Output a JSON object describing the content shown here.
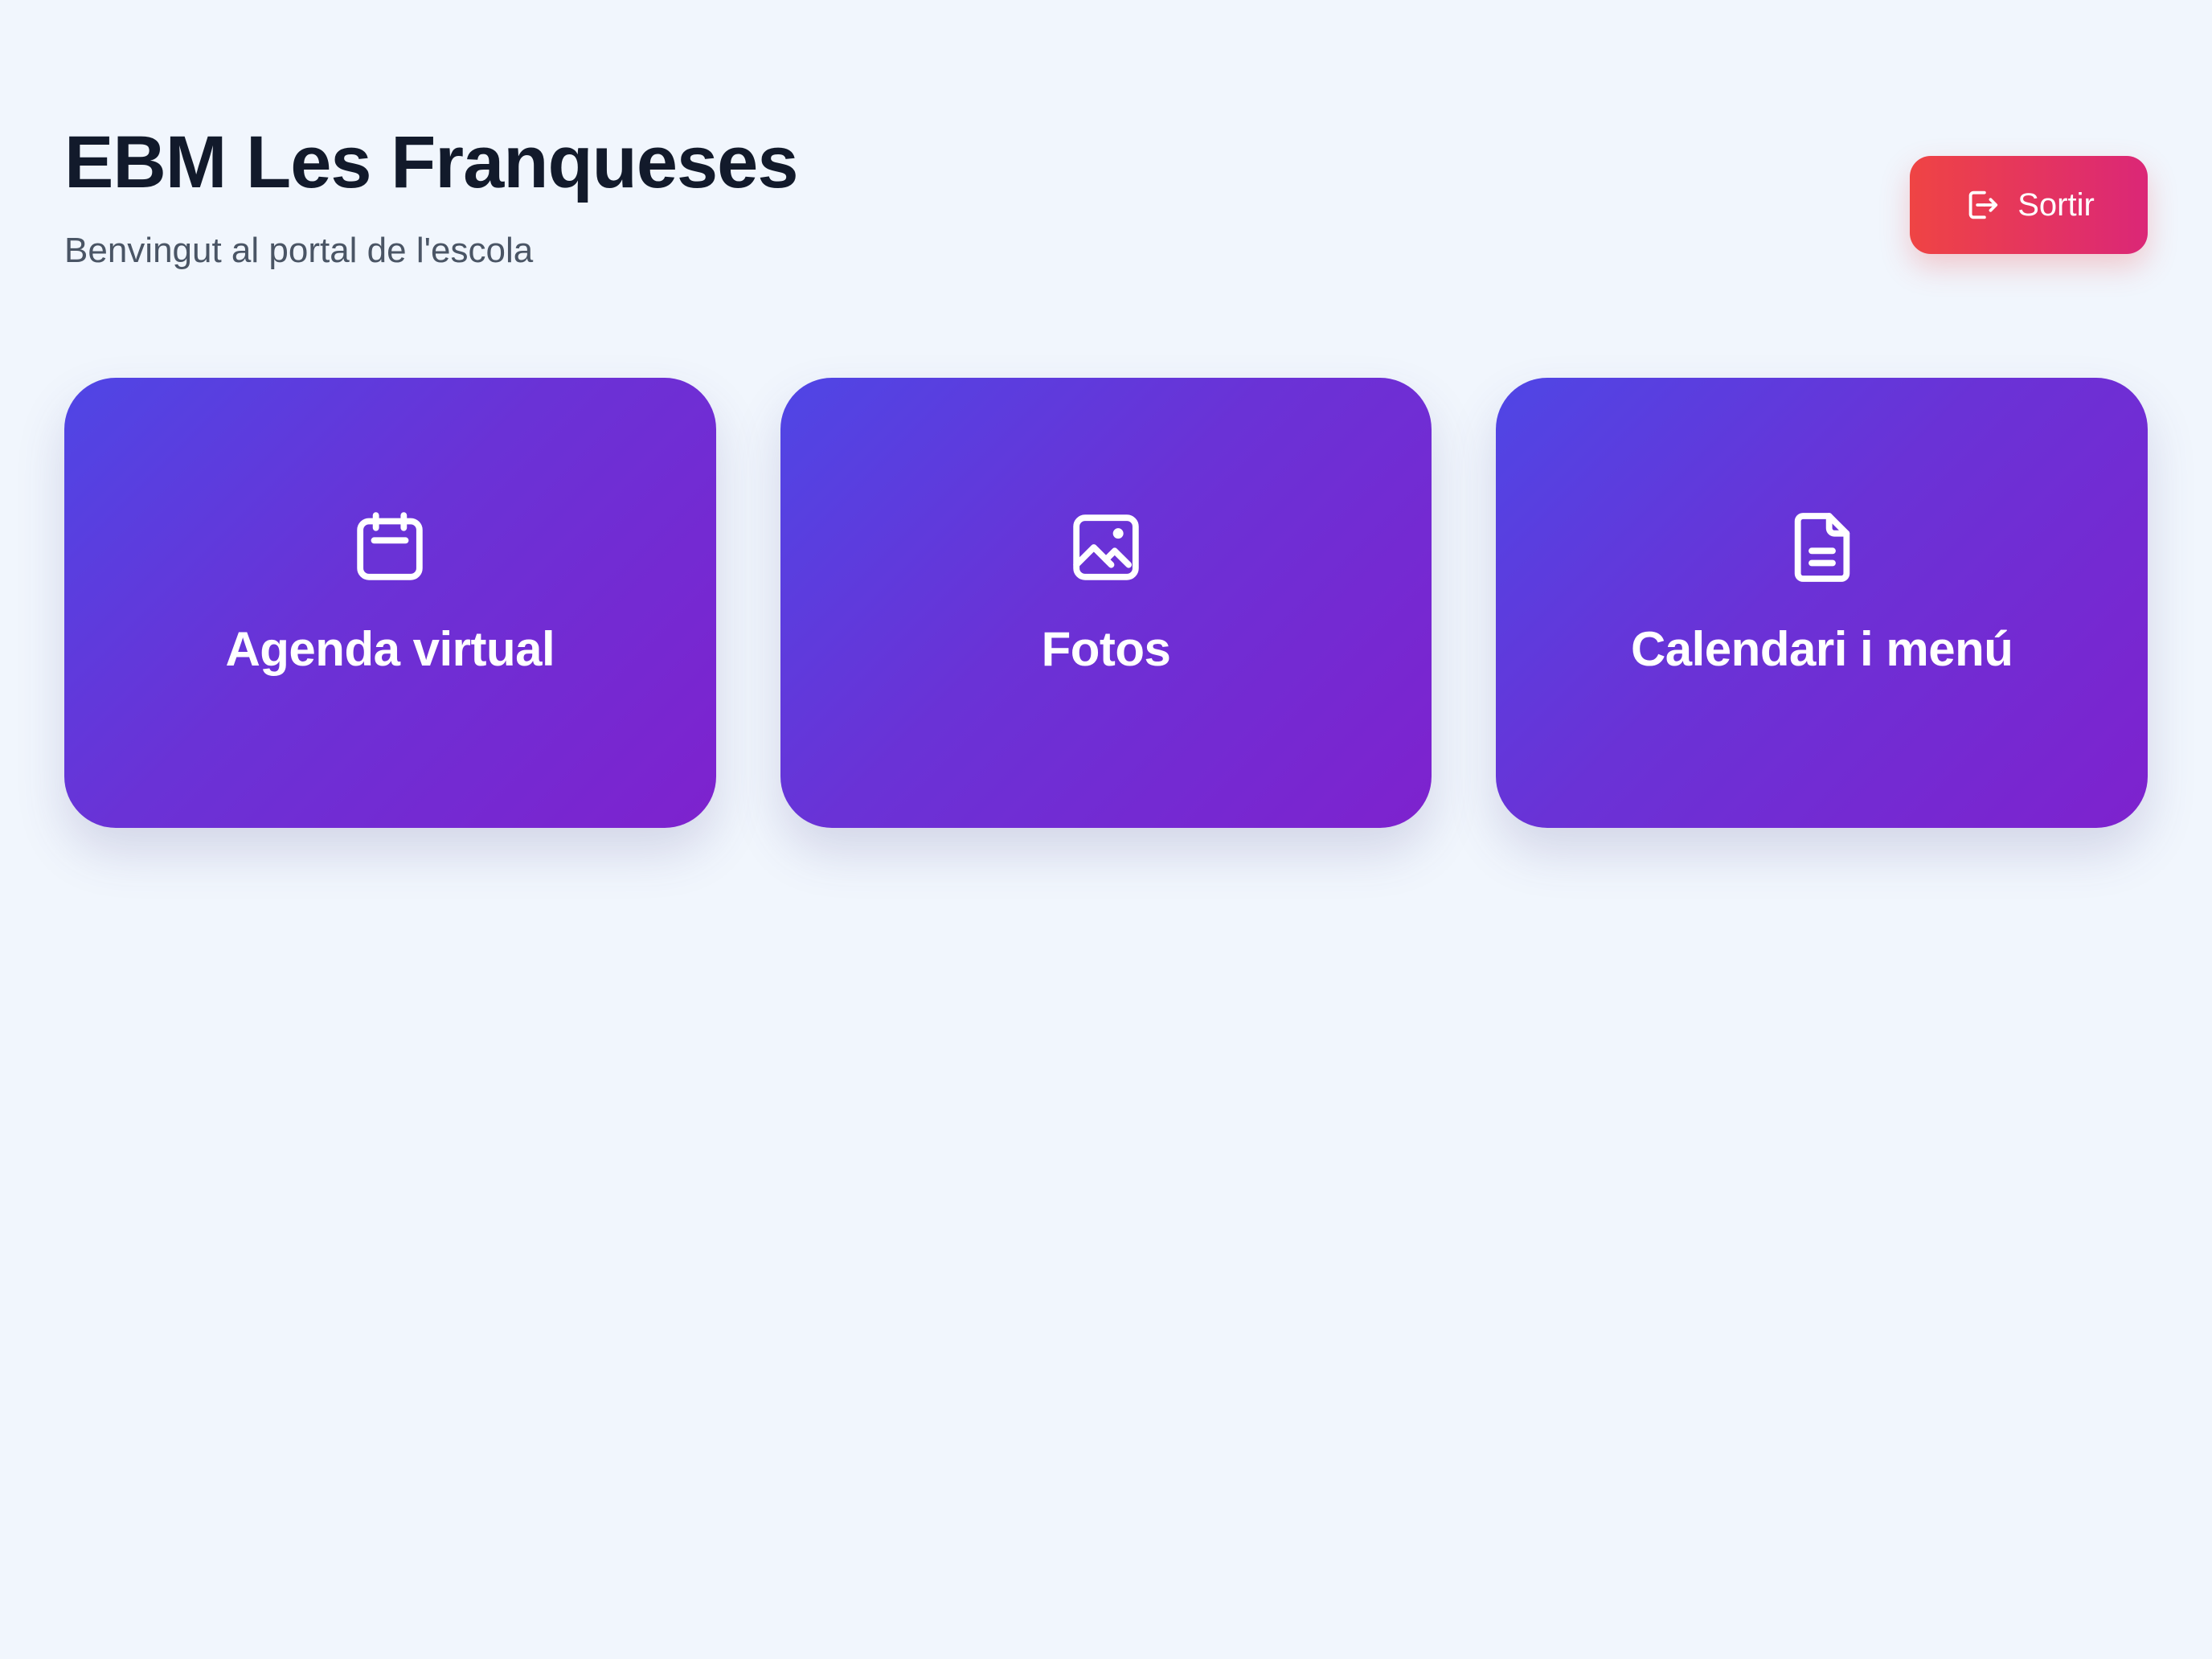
{
  "header": {
    "title": "EBM Les Franqueses",
    "subtitle": "Benvingut al portal de l'escola",
    "logout_label": "Sortir",
    "logout_icon": "logout-icon"
  },
  "cards": [
    {
      "label": "Agenda virtual",
      "icon": "calendar-icon"
    },
    {
      "label": "Fotos",
      "icon": "image-icon"
    },
    {
      "label": "Calendari i menú",
      "icon": "document-icon"
    }
  ],
  "colors": {
    "background": "#f1f6fd",
    "card_gradient_start": "#4f46e5",
    "card_gradient_end": "#7e22ce",
    "logout_gradient_start": "#ef4444",
    "logout_gradient_end": "#db2777",
    "title": "#121a2b",
    "subtitle": "#4a5565"
  }
}
